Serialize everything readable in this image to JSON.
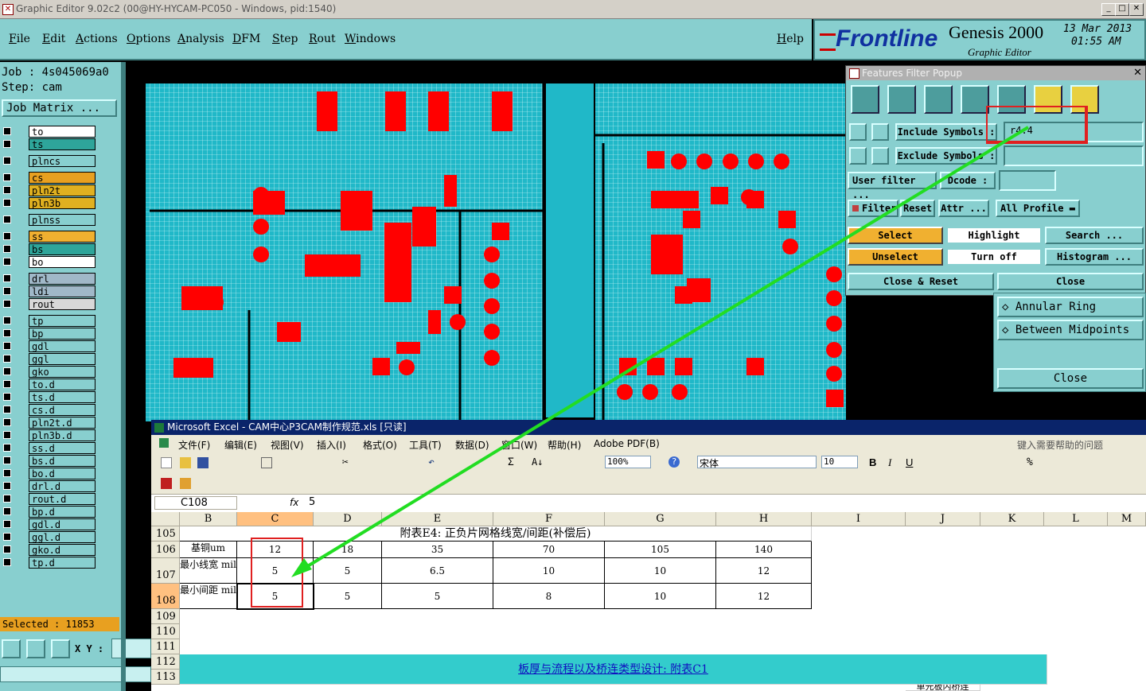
{
  "window": {
    "title": "Graphic Editor 9.02c2 (00@HY-HYCAM-PC050 - Windows, pid:1540)"
  },
  "menu": {
    "items": [
      "File",
      "Edit",
      "Actions",
      "Options",
      "Analysis",
      "DFM",
      "Step",
      "Rout",
      "Windows"
    ],
    "help": "Help"
  },
  "brand": {
    "logo": "Frontline",
    "product": "Genesis 2000",
    "subtitle": "Graphic Editor",
    "date": "13 Mar 2013",
    "time": "01:55 AM"
  },
  "job": {
    "job_label": "Job : 4s045069a0",
    "step_label": "Step: cam",
    "matrix_button": "Job Matrix ..."
  },
  "layers": [
    {
      "name": "to",
      "color": "#ffffff"
    },
    {
      "name": "ts",
      "color": "#2ea59a"
    },
    {
      "name": "plncs",
      "color": "#88cfcf"
    },
    {
      "name": "cs",
      "color": "#e8a020"
    },
    {
      "name": "pln2t",
      "color": "#e0b020"
    },
    {
      "name": "pln3b",
      "color": "#e0b020"
    },
    {
      "name": "plnss",
      "color": "#88cfcf"
    },
    {
      "name": "ss",
      "color": "#f0b030"
    },
    {
      "name": "bs",
      "color": "#2ea59a"
    },
    {
      "name": "bo",
      "color": "#ffffff"
    },
    {
      "name": "drl",
      "color": "#a0b8c8"
    },
    {
      "name": "ldi",
      "color": "#a0b8c8"
    },
    {
      "name": "rout",
      "color": "#d8d8d8"
    },
    {
      "name": "tp",
      "color": "#88cfcf"
    },
    {
      "name": "bp",
      "color": "#88cfcf"
    },
    {
      "name": "gdl",
      "color": "#88cfcf"
    },
    {
      "name": "ggl",
      "color": "#88cfcf"
    },
    {
      "name": "gko",
      "color": "#88cfcf"
    },
    {
      "name": "to.d",
      "color": "#88cfcf"
    },
    {
      "name": "ts.d",
      "color": "#88cfcf"
    },
    {
      "name": "cs.d",
      "color": "#88cfcf"
    },
    {
      "name": "pln2t.d",
      "color": "#88cfcf"
    },
    {
      "name": "pln3b.d",
      "color": "#88cfcf"
    },
    {
      "name": "ss.d",
      "color": "#88cfcf"
    },
    {
      "name": "bs.d",
      "color": "#88cfcf"
    },
    {
      "name": "bo.d",
      "color": "#88cfcf"
    },
    {
      "name": "drl.d",
      "color": "#88cfcf"
    },
    {
      "name": "rout.d",
      "color": "#88cfcf"
    },
    {
      "name": "bp.d",
      "color": "#88cfcf"
    },
    {
      "name": "gdl.d",
      "color": "#88cfcf"
    },
    {
      "name": "ggl.d",
      "color": "#88cfcf"
    },
    {
      "name": "gko.d",
      "color": "#88cfcf"
    },
    {
      "name": "tp.d",
      "color": "#88cfcf"
    }
  ],
  "status": {
    "selected": "Selected : 11853",
    "xy_label": "X Y :"
  },
  "filter_popup": {
    "title": "Features Filter Popup",
    "include_symbols_label": "Include Symbols :",
    "include_symbols_value": "r4.4",
    "exclude_symbols_label": "Exclude Symbols :",
    "exclude_symbols_value": "",
    "user_filter": "User filter ...",
    "dcode_label": "Dcode :",
    "filter_label": "Filter",
    "reset": "Reset",
    "attr": "Attr ...",
    "all_profile": "All Profile",
    "select": "Select",
    "highlight": "Highlight",
    "search": "Search ...",
    "unselect": "Unselect",
    "turn_off": "Turn off",
    "histogram": "Histogram ...",
    "close_reset": "Close & Reset",
    "close": "Close"
  },
  "side_panel": {
    "annular_ring": "Annular Ring",
    "between_midpoints": "Between Midpoints",
    "close": "Close"
  },
  "excel": {
    "title": "Microsoft Excel - CAM中心P3CAM制作规范.xls [只读]",
    "menu": [
      "文件(F)",
      "编辑(E)",
      "视图(V)",
      "插入(I)",
      "格式(O)",
      "工具(T)",
      "数据(D)",
      "窗口(W)",
      "帮助(H)",
      "Adobe PDF(B)"
    ],
    "help_box": "键入需要帮助的问题",
    "zoom": "100%",
    "font": "宋体",
    "font_size": "10",
    "name_box": "C108",
    "fx": "fx",
    "formula": "5",
    "columns": [
      "B",
      "C",
      "D",
      "E",
      "F",
      "G",
      "H",
      "I",
      "J",
      "K",
      "L",
      "M"
    ],
    "rows": [
      "105",
      "106",
      "107",
      "108",
      "109",
      "110",
      "111",
      "112",
      "113"
    ],
    "table_title": "附表E4: 正负片网格线宽/间距(补偿后)",
    "row106": [
      "基铜um",
      "12",
      "18",
      "35",
      "70",
      "105",
      "140"
    ],
    "row107": [
      "最小线宽 mil",
      "5",
      "5",
      "6.5",
      "10",
      "10",
      "12"
    ],
    "row108": [
      "最小间距 mil",
      "5",
      "5",
      "5",
      "8",
      "10",
      "12"
    ],
    "link": "板厚与流程以及桥连类型设计: 附表C1",
    "partial_cell": "单元板内桥连"
  }
}
